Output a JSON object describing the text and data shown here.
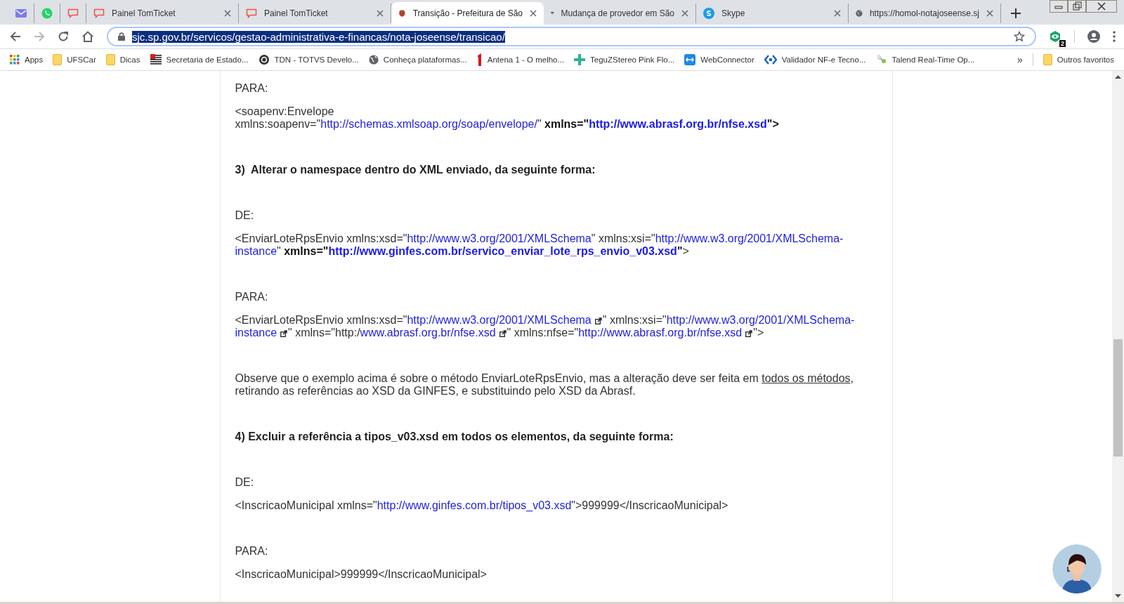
{
  "tabs": [
    {
      "selected": false
    },
    {
      "selected": false
    },
    {
      "selected": false
    },
    {
      "title": "Painel TomTicket",
      "selected": false
    },
    {
      "title": "Painel TomTicket",
      "selected": false
    },
    {
      "title": "Transição - Prefeitura de São",
      "selected": true
    },
    {
      "title": "Mudança de provedor em São",
      "selected": false
    },
    {
      "title": "Skype",
      "selected": false
    },
    {
      "title": "https://homol-notajoseense.sj",
      "selected": false
    }
  ],
  "address": "sjc.sp.gov.br/servicos/gestao-administrativa-e-financas/nota-joseense/transicao/",
  "extension_badge": "2",
  "bookmarks": [
    "Apps",
    "UFSCar",
    "Dicas",
    "Secretaria de Estado...",
    "TDN - TOTVS Develo...",
    "Conheça plataformas...",
    "Antena 1 - O melho...",
    "TeguZStereo Pink Flo...",
    "WebConnector",
    "Validador NF-e Tecno...",
    "Talend Real-Time Op..."
  ],
  "bookmarks_more": "»",
  "other_bookmarks": "Outros favoritos",
  "content": [
    {
      "kind": "label",
      "lines": [
        [
          {
            "kind": "text",
            "t": "PARA:"
          }
        ]
      ]
    },
    {
      "kind": "code",
      "lines": [
        [
          {
            "kind": "text",
            "t": "<soapenv:Envelope"
          }
        ],
        [
          {
            "kind": "text",
            "t": "xmlns:soapenv=\""
          },
          {
            "kind": "link",
            "t": "http://schemas.xmlsoap.org/soap/envelope/"
          },
          {
            "kind": "text",
            "t": "\" "
          },
          {
            "kind": "text",
            "t": "xmlns=\"",
            "bold": true
          },
          {
            "kind": "link",
            "t": "http://www.abrasf.org.br/nfse.xsd",
            "bold": true
          },
          {
            "kind": "text",
            "t": "\">",
            "bold": true
          }
        ]
      ]
    },
    {
      "kind": "heading",
      "lines": [
        [
          {
            "kind": "text",
            "t": "3)  Alterar o namespace dentro do XML enviado, da seguinte forma:"
          }
        ]
      ]
    },
    {
      "kind": "label",
      "lines": [
        [
          {
            "kind": "text",
            "t": "DE:"
          }
        ]
      ]
    },
    {
      "kind": "code",
      "lines": [
        [
          {
            "kind": "text",
            "t": "<EnviarLoteRpsEnvio xmlns:xsd=\""
          },
          {
            "kind": "link",
            "t": "http://www.w3.org/2001/XMLSchema"
          },
          {
            "kind": "text",
            "t": "\" xmlns:xsi=\""
          },
          {
            "kind": "link",
            "t": "http://www.w3.org/2001/XMLSchema-"
          }
        ],
        [
          {
            "kind": "link",
            "t": "instance"
          },
          {
            "kind": "text",
            "t": "\" "
          },
          {
            "kind": "text",
            "t": "xmlns=\"",
            "bold": true
          },
          {
            "kind": "link",
            "t": "http://www.ginfes.com.br/servico_enviar_lote_rps_envio_v03.xsd",
            "bold": true
          },
          {
            "kind": "text",
            "t": "\"",
            "bold": true
          },
          {
            "kind": "text",
            "t": ">"
          }
        ]
      ]
    },
    {
      "kind": "label",
      "lines": [
        [
          {
            "kind": "text",
            "t": "PARA:"
          }
        ]
      ]
    },
    {
      "kind": "code",
      "lines": [
        [
          {
            "kind": "text",
            "t": "<EnviarLoteRpsEnvio xmlns:xsd=\""
          },
          {
            "kind": "link",
            "t": "http://www.w3.org/2001/XMLSchema",
            "external": true
          },
          {
            "kind": "text",
            "t": "\" xmlns:xsi=\""
          },
          {
            "kind": "link",
            "t": "http://www.w3.org/2001/XMLSchema-"
          }
        ],
        [
          {
            "kind": "link",
            "t": "instance",
            "external": true
          },
          {
            "kind": "text",
            "t": "\" xmlns=\"http:/"
          },
          {
            "kind": "link",
            "t": "www.abrasf.org.br/nfse.xsd",
            "external": true
          },
          {
            "kind": "text",
            "t": "\" xmlns:nfse=\""
          },
          {
            "kind": "link",
            "t": "http://www.abrasf.org.br/nfse.xsd",
            "external": true
          },
          {
            "kind": "text",
            "t": "\">"
          }
        ]
      ]
    },
    {
      "kind": "note",
      "lines": [
        [
          {
            "kind": "text",
            "t": "Observe que o exemplo acima é sobre o método EnviarLoteRpsEnvio, mas a alteração deve ser feita em "
          },
          {
            "kind": "underlined",
            "t": "todos os métodos"
          },
          {
            "kind": "text",
            "t": ","
          }
        ],
        [
          {
            "kind": "text",
            "t": "retirando as referências ao XSD da GINFES, e substituindo pelo XSD da Abrasf."
          }
        ]
      ]
    },
    {
      "kind": "heading",
      "lines": [
        [
          {
            "kind": "text",
            "t": "4) Excluir a referência a tipos_v03.xsd em todos os elementos, da seguinte forma:"
          }
        ]
      ]
    },
    {
      "kind": "label",
      "lines": [
        [
          {
            "kind": "text",
            "t": "DE:"
          }
        ]
      ]
    },
    {
      "kind": "code",
      "lines": [
        [
          {
            "kind": "text",
            "t": "<InscricaoMunicipal xmlns=\""
          },
          {
            "kind": "link",
            "t": "http://www.ginfes.com.br/tipos_v03.xsd"
          },
          {
            "kind": "text",
            "t": "\">999999</InscricaoMunicipal>"
          }
        ]
      ]
    },
    {
      "kind": "label",
      "lines": [
        [
          {
            "kind": "text",
            "t": "PARA:"
          }
        ]
      ]
    },
    {
      "kind": "code",
      "lines": [
        [
          {
            "kind": "text",
            "t": "<InscricaoMunicipal>999999</InscricaoMunicipal>"
          }
        ]
      ]
    }
  ]
}
